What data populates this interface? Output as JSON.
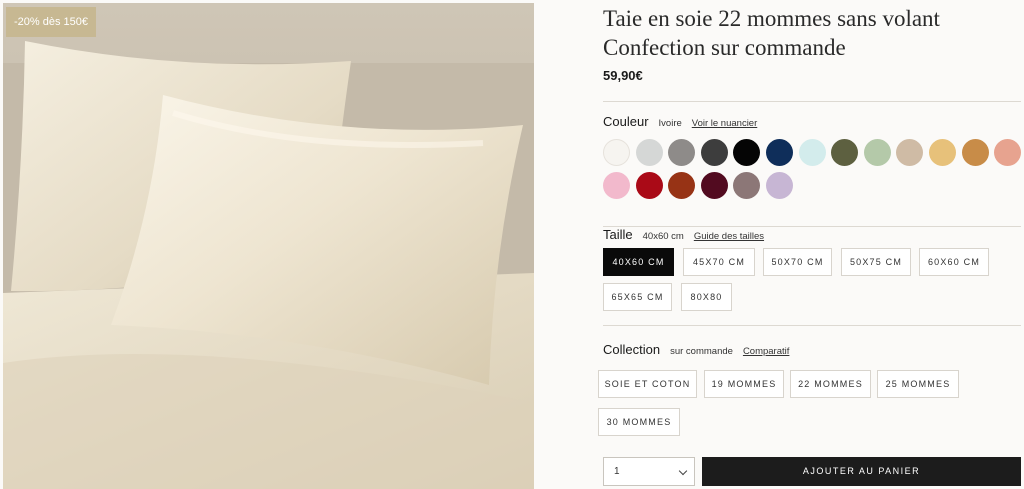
{
  "promo": {
    "badge": "-20% dès 150€"
  },
  "product": {
    "title": "Taie en soie 22 mommes sans volant Confection sur commande",
    "price": "59,90€"
  },
  "color": {
    "label": "Couleur",
    "selected": "Ivoire",
    "link": "Voir le nuancier",
    "swatches": [
      "#f6f4f0",
      "#d5d7d6",
      "#8e8b89",
      "#3d3d3d",
      "#050505",
      "#0f2e5a",
      "#d3ecec",
      "#5d6040",
      "#b4c9a9",
      "#cfbba5",
      "#e7c17a",
      "#c88c48",
      "#e7a38f",
      "#f2b9cc",
      "#aa0a17",
      "#973315",
      "#520b20",
      "#8c7777",
      "#c7b6d4"
    ]
  },
  "size": {
    "label": "Taille",
    "selected": "40x60 cm",
    "link": "Guide des tailles",
    "options": [
      "40X60 CM",
      "45X70 CM",
      "50X70 CM",
      "50X75 CM",
      "60X60 CM",
      "65X65 CM",
      "80X80"
    ]
  },
  "collection": {
    "label": "Collection",
    "selected": "sur commande",
    "link": "Comparatif",
    "options": [
      "SOIE ET COTON",
      "19 MOMMES",
      "22 MOMMES",
      "25 MOMMES",
      "30 MOMMES"
    ]
  },
  "cart": {
    "quantity": "1",
    "button": "AJOUTER AU PANIER"
  }
}
